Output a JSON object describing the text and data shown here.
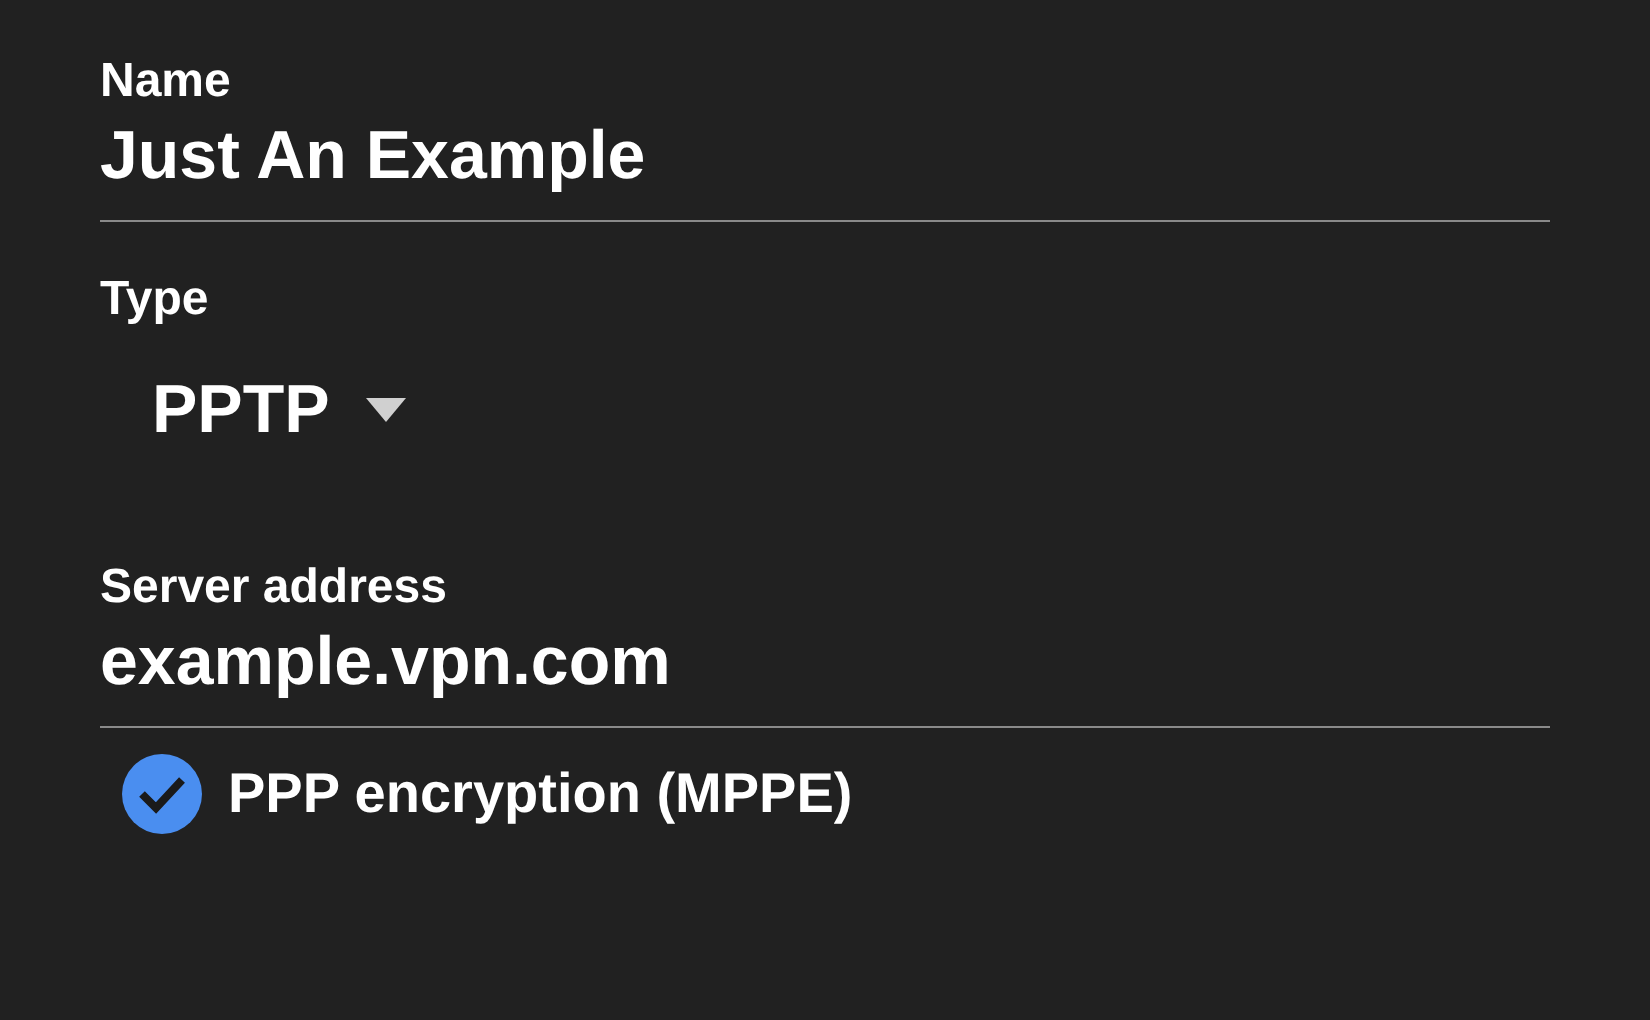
{
  "name_field": {
    "label": "Name",
    "value": "Just An Example"
  },
  "type_field": {
    "label": "Type",
    "value": "PPTP"
  },
  "server_field": {
    "label": "Server address",
    "value": "example.vpn.com"
  },
  "encryption": {
    "label": "PPP encryption (MPPE)",
    "checked": true
  }
}
